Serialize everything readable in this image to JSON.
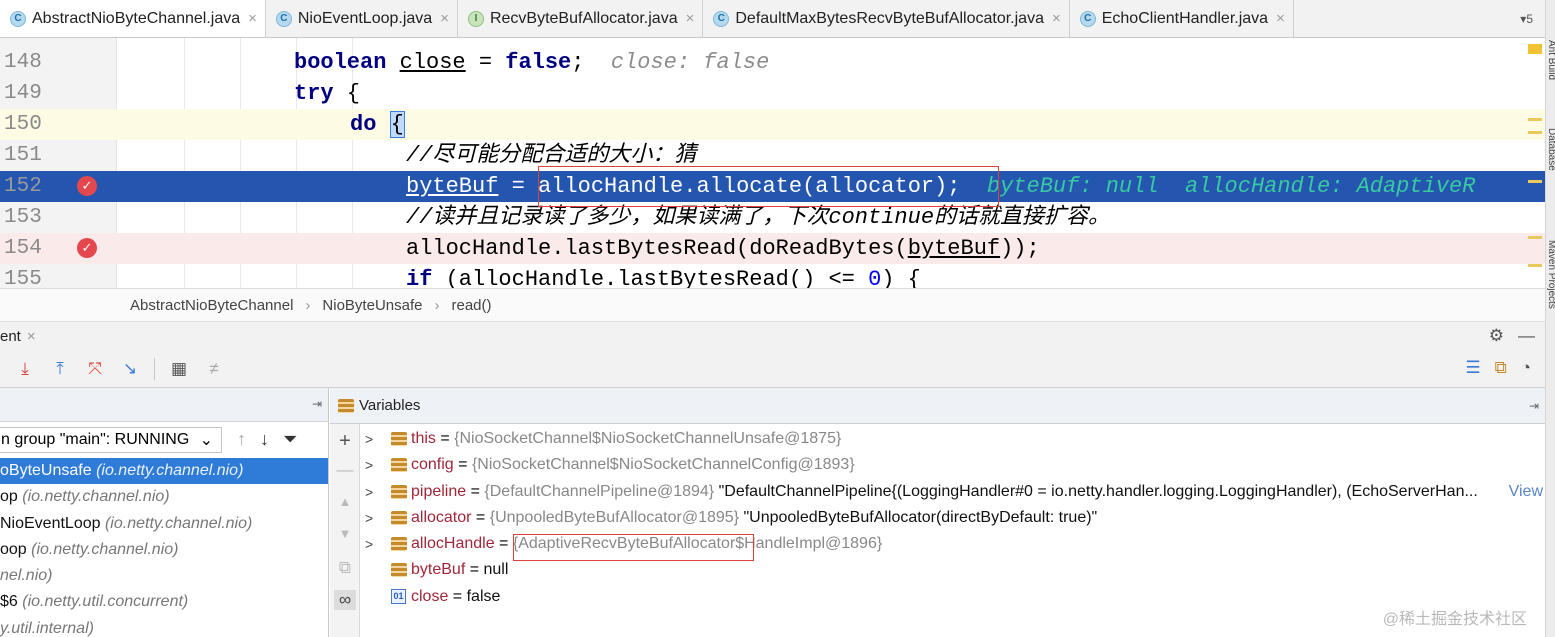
{
  "tabs": [
    {
      "label": "AbstractNioByteChannel.java",
      "icon": "C",
      "active": true
    },
    {
      "label": "NioEventLoop.java",
      "icon": "C"
    },
    {
      "label": "RecvByteBufAllocator.java",
      "icon": "I"
    },
    {
      "label": "DefaultMaxBytesRecvByteBufAllocator.java",
      "icon": "C"
    },
    {
      "label": "EchoClientHandler.java",
      "icon": "C"
    }
  ],
  "tab_close": "×",
  "tabs_more": "▾5",
  "editor": {
    "lines": [
      {
        "num": "148",
        "kw1": "boolean",
        "sp1": " ",
        "var": "close",
        "rest": " = ",
        "kw2": "false",
        "semi": ";  ",
        "hint": "close: false"
      },
      {
        "num": "149",
        "kw": "try",
        "rest": " {"
      },
      {
        "num": "150",
        "kw": "do",
        "brace": "{"
      },
      {
        "num": "151",
        "comment": "//尽可能分配合适的大小：猜"
      },
      {
        "num": "152",
        "var": "byteBuf",
        "mid": " = ",
        "call": "allocHandle.allocate(allocator);",
        "hint": "byteBuf: null  allocHandle: AdaptiveR"
      },
      {
        "num": "153",
        "comment": "//读并且记录读了多少，如果读满了，下次continue的话就直接扩容。"
      },
      {
        "num": "154",
        "pre": "allocHandle.lastBytesRead(doReadBytes(",
        "var": "byteBuf",
        "post": "));"
      },
      {
        "num": "155",
        "kw": "if",
        "pre": " (allocHandle.lastBytesRead() <= ",
        "n": "0",
        "post": ") {"
      }
    ],
    "breakpoint_glyph": "✓"
  },
  "breadcrumb": [
    "AbstractNioByteChannel",
    "NioByteUnsafe",
    "read()"
  ],
  "breadcrumb_sep": "›",
  "debug": {
    "tab_label": "ent",
    "tab_close": "×",
    "header_icons": [
      "⚙",
      "—"
    ],
    "toolbar": [
      "⤓",
      "⤒",
      "⤧",
      "↘",
      "▦",
      "≠"
    ],
    "toolbar_right": [
      "☰",
      "⧉",
      "◔"
    ],
    "frames": {
      "pin": "⇥",
      "thread": "n group \"main\": RUNNING",
      "thread_chevron": "⌄",
      "tools": [
        "↑",
        "↓",
        "⏷"
      ],
      "items": [
        {
          "name": "oByteUnsafe ",
          "pkg": "(io.netty.channel.nio)"
        },
        {
          "name": "op ",
          "pkg": "(io.netty.channel.nio)"
        },
        {
          "name": "NioEventLoop ",
          "pkg": "(io.netty.channel.nio)"
        },
        {
          "name": "oop ",
          "pkg": "(io.netty.channel.nio)"
        },
        {
          "name": "",
          "pkg": "nel.nio)"
        },
        {
          "name": "$6 ",
          "pkg": "(io.netty.util.concurrent)"
        },
        {
          "name": "",
          "pkg": "y.util.internal)"
        }
      ]
    },
    "variables": {
      "title": "Variables",
      "pin": "⇥",
      "side_buttons": [
        "+",
        "—",
        "▲",
        "▼",
        "⧉",
        "∞"
      ],
      "rows": [
        {
          "exp": ">",
          "name": "this",
          "eq": " = ",
          "val": "{NioSocketChannel$NioSocketChannelUnsafe@1875}",
          "str": ""
        },
        {
          "exp": ">",
          "name": "config",
          "eq": " = ",
          "val": "{NioSocketChannel$NioSocketChannelConfig@1893}",
          "str": ""
        },
        {
          "exp": ">",
          "name": "pipeline",
          "eq": " = ",
          "val": "{DefaultChannelPipeline@1894}",
          "str": " \"DefaultChannelPipeline{(LoggingHandler#0 = io.netty.handler.logging.LoggingHandler), (EchoServerHan...",
          "view": "View"
        },
        {
          "exp": ">",
          "name": "allocator",
          "eq": " = ",
          "val": "{UnpooledByteBufAllocator@1895}",
          "str": " \"UnpooledByteBufAllocator(directByDefault: true)\""
        },
        {
          "exp": ">",
          "name": "allocHandle",
          "eq": " = ",
          "val": "{AdaptiveRecvByteBufAllocator$HandleImpl@1896}",
          "str": ""
        },
        {
          "exp": "",
          "name": "byteBuf",
          "eq": " = ",
          "val": "",
          "str": "null"
        },
        {
          "exp": "",
          "name": "close",
          "eq": " = ",
          "val": "",
          "str": "false",
          "bool": true
        }
      ]
    }
  },
  "watermark": "@稀土掘金技术社区",
  "right_strip_labels": [
    "Ant Build",
    "Database",
    "Maven Projects"
  ]
}
